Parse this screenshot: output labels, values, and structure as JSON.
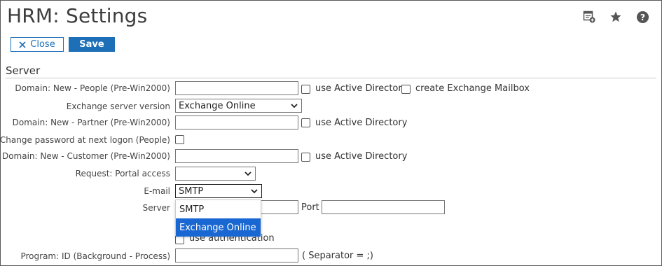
{
  "header": {
    "title": "HRM: Settings",
    "icons": [
      "add-widget-icon",
      "star-icon",
      "help-icon"
    ]
  },
  "toolbar": {
    "close_label": "Close",
    "save_label": "Save"
  },
  "section": {
    "title": "Server"
  },
  "fields": {
    "domain_people": {
      "label": "Domain: New - People (Pre-Win2000)",
      "value": "",
      "use_ad_label": "use Active Directory",
      "exchange_mailbox_label": "create Exchange Mailbox"
    },
    "exchange_version": {
      "label": "Exchange server version",
      "value": "Exchange Online"
    },
    "domain_partner": {
      "label": "Domain: New - Partner (Pre-Win2000)",
      "value": "",
      "use_ad_label": "use Active Directory"
    },
    "change_password": {
      "label": "Change password at next logon (People)"
    },
    "domain_customer": {
      "label": "Domain: New - Customer (Pre-Win2000)",
      "value": "",
      "use_ad_label": "use Active Directory"
    },
    "portal_access": {
      "label": "Request: Portal access",
      "value": ""
    },
    "email": {
      "label": "E-mail",
      "value": "SMTP",
      "options": [
        "SMTP",
        "Exchange Online"
      ],
      "highlighted_option": "Exchange Online"
    },
    "server": {
      "label": "Server",
      "value": "",
      "port_label": "Port",
      "port_value": ""
    },
    "authentication": {
      "label": "use authentication"
    },
    "program_id": {
      "label": "Program: ID (Background - Process)",
      "value": "",
      "separator_note": "( Separator = ;)"
    }
  },
  "colors": {
    "accent": "#1d6fb8",
    "highlight": "#1967d2"
  }
}
